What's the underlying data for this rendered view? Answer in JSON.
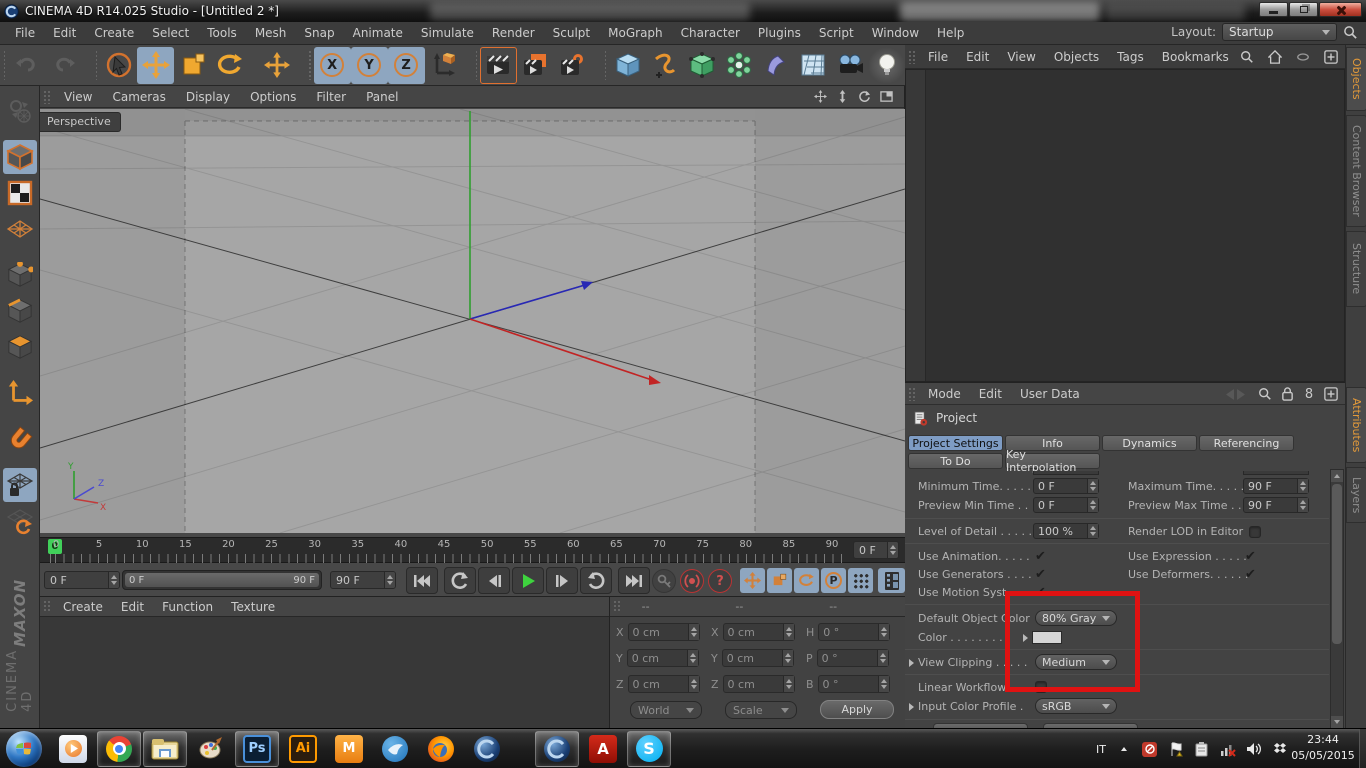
{
  "titlebar": {
    "title": "CINEMA 4D R14.025 Studio - [Untitled 2 *]"
  },
  "menubar": {
    "items": [
      "File",
      "Edit",
      "Create",
      "Select",
      "Tools",
      "Mesh",
      "Snap",
      "Animate",
      "Simulate",
      "Render",
      "Sculpt",
      "MoGraph",
      "Character",
      "Plugins",
      "Script",
      "Window",
      "Help"
    ],
    "layout_label": "Layout:",
    "layout_value": "Startup"
  },
  "toolbar": {
    "axis_labels": [
      "X",
      "Y",
      "Z"
    ]
  },
  "viewport": {
    "menu": [
      "View",
      "Cameras",
      "Display",
      "Options",
      "Filter",
      "Panel"
    ],
    "camera_label": "Perspective",
    "axis_x": "X",
    "axis_y": "Y",
    "axis_z": "Z"
  },
  "timeline": {
    "tick_labels": [
      "0",
      "5",
      "10",
      "15",
      "20",
      "25",
      "30",
      "35",
      "40",
      "45",
      "50",
      "55",
      "60",
      "65",
      "70",
      "75",
      "80",
      "85",
      "90"
    ],
    "playhead_frame": "0",
    "frame_field": "0 F",
    "current_field": "0 F",
    "range_start": "0 F",
    "range_end": "90 F",
    "end_field": "90 F"
  },
  "materials": {
    "menu": [
      "Create",
      "Edit",
      "Function",
      "Texture"
    ]
  },
  "coords": {
    "headers": [
      "--",
      "--",
      "--"
    ],
    "col1": {
      "x": {
        "l": "X",
        "v": "0 cm"
      },
      "y": {
        "l": "Y",
        "v": "0 cm"
      },
      "z": {
        "l": "Z",
        "v": "0 cm"
      }
    },
    "col2": {
      "x": {
        "l": "X",
        "v": "0 cm"
      },
      "y": {
        "l": "Y",
        "v": "0 cm"
      },
      "z": {
        "l": "Z",
        "v": "0 cm"
      }
    },
    "col3": {
      "h": {
        "l": "H",
        "v": "0 °"
      },
      "p": {
        "l": "P",
        "v": "0 °"
      },
      "b": {
        "l": "B",
        "v": "0 °"
      }
    },
    "system1": "World",
    "system2": "Scale",
    "apply_label": "Apply"
  },
  "objects": {
    "menu": [
      "File",
      "Edit",
      "View",
      "Objects",
      "Tags",
      "Bookmarks"
    ]
  },
  "side_tabs": {
    "top": [
      "Objects",
      "Content Browser",
      "Structure"
    ],
    "bottom": [
      "Attributes",
      "Layers"
    ]
  },
  "attributes": {
    "menu": [
      "Mode",
      "Edit",
      "User Data"
    ],
    "object_title": "Project",
    "tabs": [
      "Project Settings",
      "Info",
      "Dynamics",
      "Referencing",
      "To Do",
      "Key Interpolation"
    ],
    "active_tab": "Project Settings",
    "fields": {
      "minimum_time": {
        "label": "Minimum Time. . . . .",
        "value": "0 F"
      },
      "maximum_time": {
        "label": "Maximum Time. . . . . .",
        "value": "90 F"
      },
      "preview_min_time": {
        "label": "Preview Min Time . .",
        "value": "0 F"
      },
      "preview_max_time": {
        "label": "Preview Max Time . . .",
        "value": "90 F"
      },
      "level_of_detail": {
        "label": "Level of Detail . . . . .",
        "value": "100 %"
      },
      "render_lod": {
        "label": "Render LOD in Editor",
        "checked": false
      },
      "use_animation": {
        "label": "Use Animation. . . . .",
        "checked": true
      },
      "use_expression": {
        "label": "Use Expression . . . . .",
        "checked": true
      },
      "use_generators": {
        "label": "Use Generators . . . .",
        "checked": true
      },
      "use_deformers": {
        "label": "Use Deformers. . . . . .",
        "checked": true
      },
      "use_motion_system": {
        "label": "Use Motion Syst . . . .",
        "checked": true
      },
      "default_object_color": {
        "label": "Default Object Color",
        "value": "80% Gray"
      },
      "color": {
        "label": "Color . . . . . . . . .",
        "swatch": "#d6d6d6"
      },
      "view_clipping": {
        "label": "View Clipping . . . . .",
        "value": "Medium"
      },
      "linear_workflow": {
        "label": "Linear Workflow . . .",
        "checked": false
      },
      "input_color_profile": {
        "label": "Input Color Profile .",
        "value": "sRGB"
      }
    }
  },
  "annotation": {
    "color": "#e01212"
  },
  "taskbar": {
    "language": "IT",
    "time": "23:44",
    "date": "05/05/2015",
    "app_labels": {
      "photoshop": "Ps",
      "illustrator": "Ai",
      "maxon": "M",
      "acrobat": "A",
      "skype": "S"
    }
  },
  "icons": {
    "check": "✔",
    "question": "?",
    "p_track": "P",
    "history_8": "8"
  },
  "colors": {
    "accent_orange": "#e8a23a",
    "selection_blue": "#8ea6c0",
    "tab_active_blue": "#7e9cc4",
    "playhead_green": "#41d05a"
  }
}
